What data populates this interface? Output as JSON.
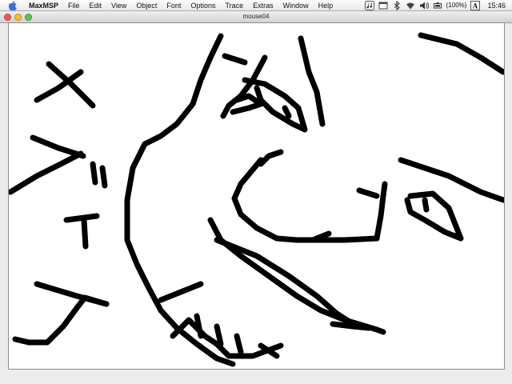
{
  "menubar": {
    "apple_icon": "apple-icon",
    "items": [
      {
        "label": "MaxMSP"
      },
      {
        "label": "File"
      },
      {
        "label": "Edit"
      },
      {
        "label": "View"
      },
      {
        "label": "Object"
      },
      {
        "label": "Font"
      },
      {
        "label": "Options"
      },
      {
        "label": "Trace"
      },
      {
        "label": "Extras"
      },
      {
        "label": "Window"
      },
      {
        "label": "Help"
      }
    ],
    "status": {
      "battery_text": "(100%)",
      "input_menu": "A",
      "clock": "15:46"
    }
  },
  "window": {
    "title": "mouse04",
    "colors": {
      "close": "#ee5b52",
      "minimize": "#f5bd3a",
      "zoom": "#5bc647",
      "stroke": "#000000",
      "canvas_bg": "#ffffff"
    }
  }
}
